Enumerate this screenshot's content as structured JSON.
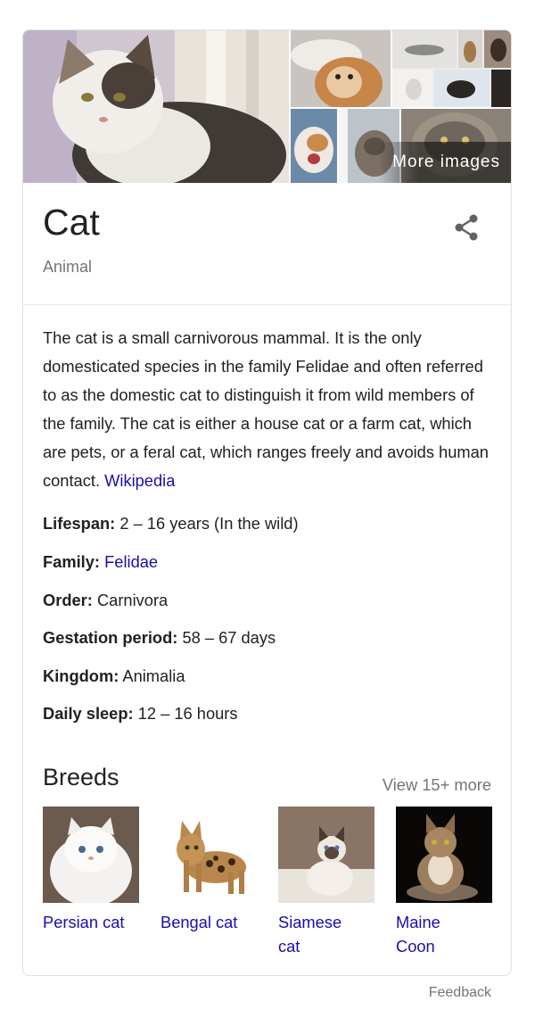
{
  "mosaic": {
    "more_images_label": "More images"
  },
  "entity": {
    "title": "Cat",
    "subtitle": "Animal",
    "description": "The cat is a small carnivorous mammal. It is the only domesticated species in the family Felidae and often referred to as the domestic cat to distinguish it from wild members of the family. The cat is either a house cat or a farm cat, which are pets, or a feral cat, which ranges freely and avoids human contact.",
    "source_link": "Wikipedia"
  },
  "facts": [
    {
      "label": "Lifespan:",
      "value": "2 – 16 years (In the wild)",
      "is_link": false
    },
    {
      "label": "Family:",
      "value": "Felidae",
      "is_link": true
    },
    {
      "label": "Order:",
      "value": "Carnivora",
      "is_link": false
    },
    {
      "label": "Gestation period:",
      "value": "58 – 67 days",
      "is_link": false
    },
    {
      "label": "Kingdom:",
      "value": "Animalia",
      "is_link": false
    },
    {
      "label": "Daily sleep:",
      "value": "12 – 16 hours",
      "is_link": false
    }
  ],
  "breeds": {
    "title": "Breeds",
    "view_more": "View 15+ more",
    "items": [
      {
        "name_line1": "Persian cat",
        "name_line2": ""
      },
      {
        "name_line1": "Bengal cat",
        "name_line2": ""
      },
      {
        "name_line1": "Siamese",
        "name_line2": "cat"
      },
      {
        "name_line1": "Maine",
        "name_line2": "Coon"
      }
    ]
  },
  "footer": {
    "feedback": "Feedback"
  },
  "icons": {
    "share": "share-icon"
  },
  "colors": {
    "link": "#1a0dab",
    "secondary_text": "#70757a",
    "border": "#dfe1e5"
  }
}
